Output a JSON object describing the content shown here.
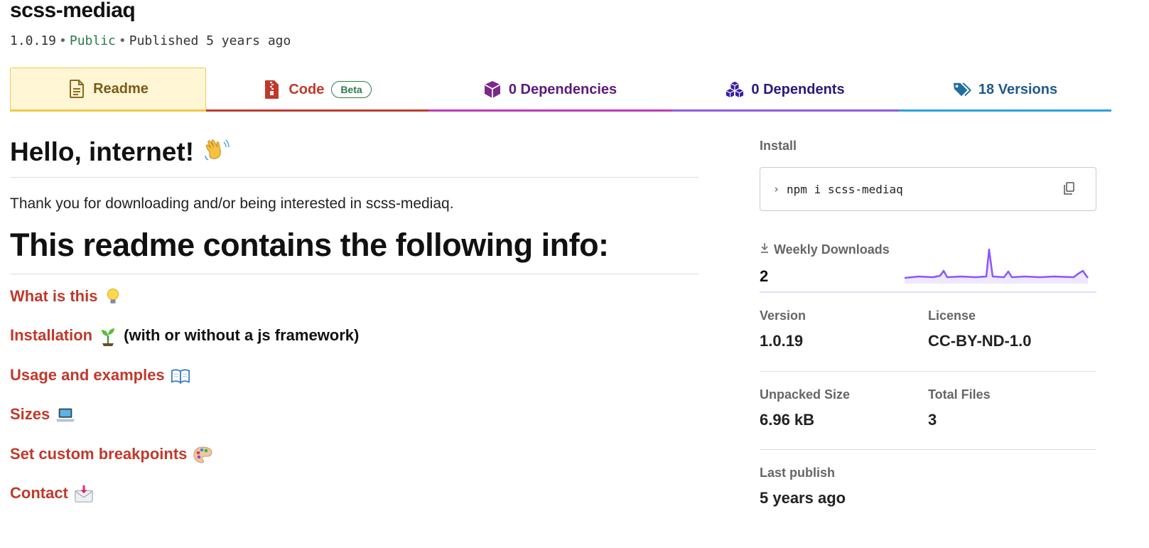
{
  "package": {
    "name": "scss-mediaq",
    "version": "1.0.19",
    "visibility": "Public",
    "published": "Published 5 years ago"
  },
  "tabs": [
    {
      "label": "Readme",
      "icon": "file-icon"
    },
    {
      "label": "Code",
      "badge": "Beta",
      "icon": "zip-file-icon"
    },
    {
      "label": "0 Dependencies",
      "icon": "box-icon"
    },
    {
      "label": "0 Dependents",
      "icon": "boxes-icon"
    },
    {
      "label": "18 Versions",
      "icon": "tags-icon"
    }
  ],
  "readme": {
    "heading": "Hello, internet!",
    "heading_emoji": "waving-hand",
    "intro": "Thank you for downloading and/or being interested in scss-mediaq.",
    "subheading": "This readme contains the following info:",
    "toc": [
      {
        "label": "What is this",
        "emoji": "light-bulb",
        "extra": ""
      },
      {
        "label": "Installation",
        "emoji": "seedling",
        "extra": "(with or without a js framework)"
      },
      {
        "label": "Usage and examples",
        "emoji": "open-book",
        "extra": ""
      },
      {
        "label": "Sizes",
        "emoji": "laptop",
        "extra": ""
      },
      {
        "label": "Set custom breakpoints",
        "emoji": "artist-palette",
        "extra": ""
      },
      {
        "label": "Contact",
        "emoji": "envelope-with-arrow",
        "extra": ""
      }
    ]
  },
  "sidebar": {
    "install_label": "Install",
    "install_prompt": "›",
    "install_command": "npm i scss-mediaq",
    "weekly_downloads_label": "Weekly Downloads",
    "weekly_downloads": "2",
    "version_label": "Version",
    "version": "1.0.19",
    "license_label": "License",
    "license": "CC-BY-ND-1.0",
    "unpacked_size_label": "Unpacked Size",
    "unpacked_size": "6.96 kB",
    "total_files_label": "Total Files",
    "total_files": "3",
    "last_publish_label": "Last publish",
    "last_publish": "5 years ago"
  },
  "colors": {
    "link": "#c0392b",
    "public": "#2c7a4b",
    "sparkline": "#8956ff"
  }
}
